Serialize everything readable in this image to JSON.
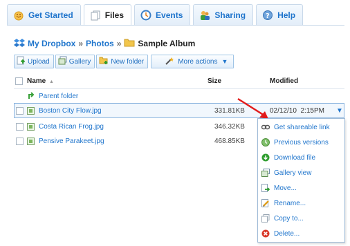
{
  "tabs": [
    {
      "label": "Get Started",
      "icon": "get-started-icon",
      "active": false
    },
    {
      "label": "Files",
      "icon": "files-icon",
      "active": true
    },
    {
      "label": "Events",
      "icon": "events-icon",
      "active": false
    },
    {
      "label": "Sharing",
      "icon": "sharing-icon",
      "active": false
    },
    {
      "label": "Help",
      "icon": "help-icon",
      "active": false
    }
  ],
  "breadcrumb": {
    "root": "My Dropbox",
    "sep": "»",
    "middle": "Photos",
    "current": "Sample Album"
  },
  "toolbar": {
    "upload": "Upload",
    "gallery": "Gallery",
    "new_folder": "New folder",
    "more_actions": "More actions"
  },
  "table": {
    "headers": {
      "name": "Name",
      "sort": "▲",
      "size": "Size",
      "modified": "Modified"
    },
    "parent": "Parent folder",
    "rows": [
      {
        "name": "Boston City Flow.jpg",
        "size": "331.81KB",
        "modified": "02/12/10  2:15PM",
        "selected": true
      },
      {
        "name": "Costa Rican Frog.jpg",
        "size": "346.32KB",
        "modified": "",
        "selected": false
      },
      {
        "name": "Pensive Parakeet.jpg",
        "size": "468.85KB",
        "modified": "",
        "selected": false
      }
    ]
  },
  "row_menu_caret": "▼",
  "context_menu": {
    "items": [
      {
        "label": "Get shareable link",
        "icon": "link-icon"
      },
      {
        "label": "Previous versions",
        "icon": "history-icon"
      },
      {
        "label": "Download file",
        "icon": "download-icon"
      },
      {
        "label": "Gallery view",
        "icon": "gallery-icon"
      },
      {
        "label": "Move...",
        "icon": "move-icon"
      },
      {
        "label": "Rename...",
        "icon": "rename-icon"
      },
      {
        "label": "Copy to...",
        "icon": "copy-icon"
      },
      {
        "label": "Delete...",
        "icon": "delete-icon"
      }
    ]
  },
  "colors": {
    "link": "#1f75cc",
    "accent_border": "#9fc4e6",
    "annotation_arrow": "#e21b1b"
  }
}
